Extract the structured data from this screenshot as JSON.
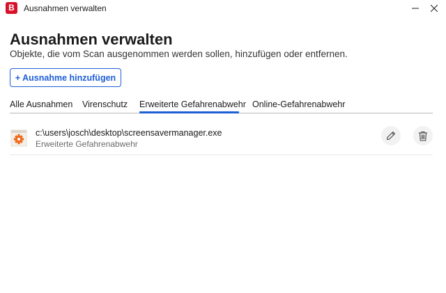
{
  "window": {
    "logo_letter": "B",
    "title": "Ausnahmen verwalten"
  },
  "header": {
    "title": "Ausnahmen verwalten",
    "subtitle": "Objekte, die vom Scan ausgenommen werden sollen, hinzufügen oder entfernen."
  },
  "actions": {
    "add_label": "+ Ausnahme hinzufügen"
  },
  "tabs": [
    {
      "label": "Alle Ausnahmen",
      "active": false
    },
    {
      "label": "Virenschutz",
      "active": false
    },
    {
      "label": "Erweiterte Gefahrenabwehr",
      "active": true
    },
    {
      "label": "Online-Gefahrenabwehr",
      "active": false
    }
  ],
  "exceptions": [
    {
      "path": "c:\\users\\josch\\desktop\\screensavermanager.exe",
      "category": "Erweiterte Gefahrenabwehr",
      "icon": "executable-file-icon"
    }
  ],
  "colors": {
    "brand": "#d8122a",
    "accent": "#1f5fd6",
    "file_icon": "#ee6a1c"
  }
}
